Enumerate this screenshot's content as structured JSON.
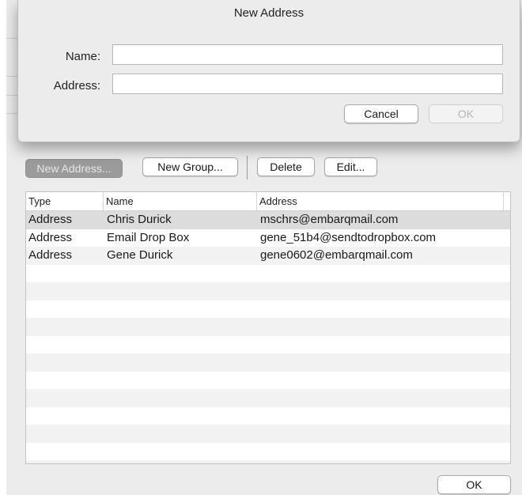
{
  "sheet": {
    "title": "New Address",
    "name_label": "Name:",
    "name_value": "",
    "address_label": "Address:",
    "address_value": "",
    "cancel_label": "Cancel",
    "ok_label": "OK"
  },
  "toolbar": {
    "new_address_label": "New Address...",
    "new_group_label": "New Group...",
    "delete_label": "Delete",
    "edit_label": "Edit..."
  },
  "table": {
    "columns": [
      "Type",
      "Name",
      "Address"
    ],
    "rows": [
      {
        "type": "Address",
        "name": "Chris Durick",
        "address": "mschrs@embarqmail.com"
      },
      {
        "type": "Address",
        "name": "Email Drop Box",
        "address": "gene_51b4@sendtodropbox.com"
      },
      {
        "type": "Address",
        "name": "Gene Durick",
        "address": "gene0602@embarqmail.com"
      }
    ]
  },
  "footer": {
    "ok_label": "OK"
  }
}
